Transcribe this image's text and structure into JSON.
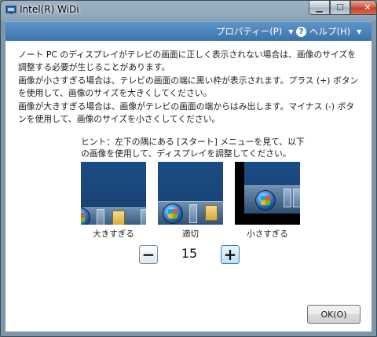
{
  "window": {
    "title": "Intel(R) WiDi",
    "close_glyph": "✕",
    "min_glyph": "▁",
    "max_glyph": "☐"
  },
  "menubar": {
    "properties_label": "プロパティー(P)",
    "help_label": "ヘルプ(H)",
    "help_icon_glyph": "?",
    "caret": "▼",
    "background": "#4a82bb"
  },
  "content": {
    "para1": "ノート PC のディスプレイがテレビの画面に正しく表示されない場合は、画像のサイズを調整する必要が生じることがあります。",
    "para2": "画像が小さすぎる場合は、テレビの画面の端に黒い枠が表示されます。プラス (+) ボタンを使用して、画像のサイズを大きくしてください。",
    "para3": "画像が大きすぎる場合は、画像がテレビの画面の端からはみ出します。マイナス (-) ボタンを使用して、画像のサイズを小さくしてください。",
    "hint": "ヒント：左下の隅にある [スタート] メニューを見て、以下の画像を使用して、ディスプレイを調整してください。",
    "examples": [
      {
        "label": "大きすぎる"
      },
      {
        "label": "適切"
      },
      {
        "label": "小さすぎる"
      }
    ]
  },
  "stepper": {
    "minus_label": "−",
    "value": "15",
    "plus_label": "+"
  },
  "footer": {
    "ok_label": "OK(O)"
  }
}
